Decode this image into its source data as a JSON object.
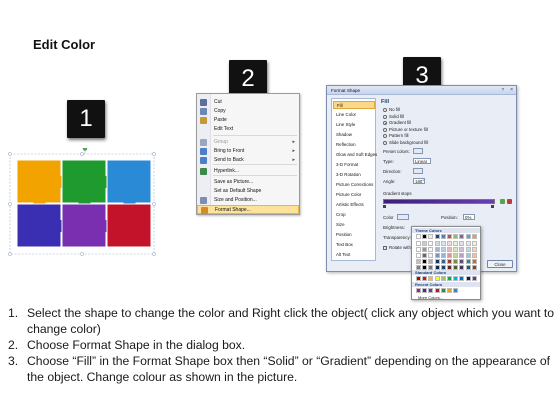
{
  "page": {
    "title": "Edit Color",
    "badges": [
      "1",
      "2",
      "3"
    ]
  },
  "puzzle": {
    "colors": [
      "#f2a300",
      "#1f9a2e",
      "#2a8ad6",
      "#3a2fb2",
      "#7a2fb0",
      "#c3132a"
    ]
  },
  "context_menu": {
    "items": [
      {
        "label": "Cut",
        "icon": "scissors-icon",
        "disabled": false,
        "arrow": false
      },
      {
        "label": "Copy",
        "icon": "copy-icon",
        "disabled": false,
        "arrow": false
      },
      {
        "label": "Paste",
        "icon": "paste-icon",
        "disabled": false,
        "arrow": false
      },
      {
        "label": "Edit Text",
        "icon": "",
        "disabled": false,
        "arrow": false
      },
      {
        "label": "Group",
        "icon": "group-icon",
        "disabled": true,
        "arrow": true
      },
      {
        "label": "Bring to Front",
        "icon": "bring-front-icon",
        "disabled": false,
        "arrow": true
      },
      {
        "label": "Send to Back",
        "icon": "send-back-icon",
        "disabled": false,
        "arrow": true
      },
      {
        "label": "Hyperlink...",
        "icon": "hyperlink-icon",
        "disabled": false,
        "arrow": false
      },
      {
        "label": "Save as Picture...",
        "icon": "",
        "disabled": false,
        "arrow": false
      },
      {
        "label": "Set as Default Shape",
        "icon": "",
        "disabled": false,
        "arrow": false
      },
      {
        "label": "Size and Position...",
        "icon": "size-icon",
        "disabled": false,
        "arrow": false
      },
      {
        "label": "Format Shape...",
        "icon": "format-shape-icon",
        "disabled": false,
        "arrow": false,
        "highlighted": true
      }
    ]
  },
  "format_dialog": {
    "title": "Format Shape",
    "help": "?",
    "close_glyph": "×",
    "categories": [
      "Fill",
      "Line Color",
      "Line Style",
      "Shadow",
      "Reflection",
      "Glow and Soft Edges",
      "3-D Format",
      "3-D Rotation",
      "Picture Corrections",
      "Picture Color",
      "Artistic Effects",
      "Crop",
      "Size",
      "Position",
      "Text Box",
      "Alt Text"
    ],
    "selected_category": "Fill",
    "section_title": "Fill",
    "fill_options": [
      {
        "label": "No fill",
        "checked": false
      },
      {
        "label": "Solid fill",
        "checked": false
      },
      {
        "label": "Gradient fill",
        "checked": true
      },
      {
        "label": "Picture or texture fill",
        "checked": false
      },
      {
        "label": "Pattern fill",
        "checked": false
      },
      {
        "label": "Slide background fill",
        "checked": false
      }
    ],
    "preset_colors_label": "Preset colors:",
    "type_label": "Type:",
    "type_value": "Linear",
    "direction_label": "Direction:",
    "angle_label": "Angle:",
    "angle_value": "180°",
    "gradient_stops_label": "Gradient stops",
    "color_label": "Color",
    "position_label": "Position:",
    "position_value": "0%",
    "brightness_label": "Brightness:",
    "transparency_label": "Transparency:",
    "rotate_label": "Rotate with shape",
    "close_button": "Close"
  },
  "color_popup": {
    "theme_title": "Theme Colors",
    "standard_title": "Standard Colors",
    "recent_title": "Recent Colors",
    "more_colors": "More Colors...",
    "theme_top": [
      "#ffffff",
      "#000000",
      "#eeece1",
      "#1f497d",
      "#4f81bd",
      "#c0504d",
      "#9bbb59",
      "#8064a2",
      "#4bacc6",
      "#f79646"
    ],
    "standard": [
      "#c00000",
      "#ff0000",
      "#ffc000",
      "#ffff00",
      "#92d050",
      "#00b050",
      "#00b0f0",
      "#0070c0",
      "#002060",
      "#7030a0"
    ],
    "recent": [
      "#e4007e",
      "#3a2fb2",
      "#7a2fb0",
      "#c3132a",
      "#1f9a2e",
      "#f2a300",
      "#2a8ad6"
    ]
  },
  "instructions": [
    {
      "n": "1.",
      "text": "Select the shape to change the color and Right click the object( click any object which you want to change color)"
    },
    {
      "n": "2.",
      "text": "Choose Format Shape in the dialog box."
    },
    {
      "n": "3.",
      "text": "Choose “Fill” in the Format Shape box then “Solid” or “Gradient” depending on the appearance of the object. Change colour as shown in the picture."
    }
  ]
}
